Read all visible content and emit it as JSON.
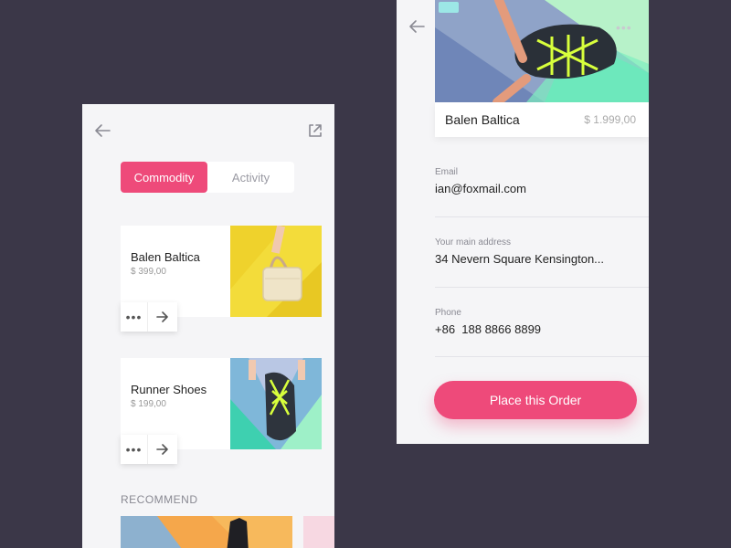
{
  "commodity_screen": {
    "tabs": {
      "active": "Commodity",
      "inactive": "Activity"
    },
    "products": [
      {
        "name": "Balen Baltica",
        "price": "$ 399,00",
        "image": "yellow-handbag"
      },
      {
        "name": "Runner Shoes",
        "price": "$ 199,00",
        "image": "runner-shoe-laces"
      }
    ],
    "recommend_label": "RECOMMEND",
    "icons": [
      "back-arrow-icon",
      "share-icon",
      "more-dots-icon",
      "arrow-right-icon"
    ]
  },
  "order_screen": {
    "product": {
      "name": "Balen Baltica",
      "price": "$ 1.999,00",
      "image": "runner-shoe-laces"
    },
    "fields": [
      {
        "label": "Email",
        "value": "ian@foxmail.com"
      },
      {
        "label": "Your main address",
        "value": "34 Nevern Square Kensington..."
      },
      {
        "label": "Phone",
        "value": "+86  188 8866 8899"
      }
    ],
    "order_button": "Place this Order",
    "icons": [
      "back-arrow-icon",
      "more-dots-icon"
    ]
  },
  "colors": {
    "background": "#3b3748",
    "accent": "#ee4a7a",
    "panel": "#f5f5f7"
  }
}
